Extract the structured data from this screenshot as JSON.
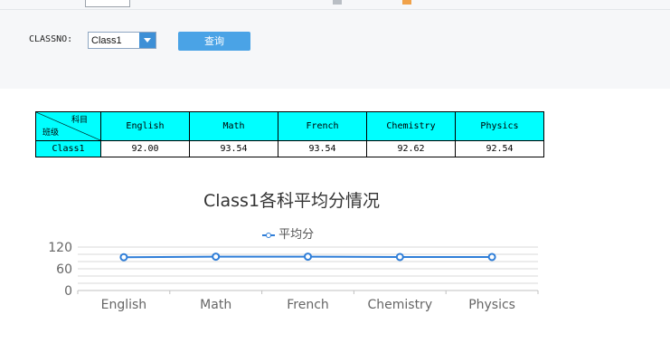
{
  "filter": {
    "classno_label": "CLASSNO:",
    "class_select_value": "Class1",
    "query_button_label": "查询"
  },
  "table": {
    "corner_top_label": "科目",
    "corner_bottom_label": "班级",
    "columns": [
      "English",
      "Math",
      "French",
      "Chemistry",
      "Physics"
    ],
    "rows": [
      {
        "class_name": "Class1",
        "scores": [
          "92.00",
          "93.54",
          "93.54",
          "92.62",
          "92.54"
        ]
      }
    ],
    "header_color": "#00ffff"
  },
  "chart_data": {
    "type": "line",
    "title": "Class1各科平均分情况",
    "categories": [
      "English",
      "Math",
      "French",
      "Chemistry",
      "Physics"
    ],
    "series": [
      {
        "name": "平均分",
        "values": [
          92.0,
          93.54,
          93.54,
          92.62,
          92.54
        ],
        "color": "#2f7ed8"
      }
    ],
    "ylim": [
      0,
      120
    ],
    "yticks": [
      "0",
      "60",
      "120"
    ],
    "grid": true,
    "legend_position": "top-center"
  }
}
